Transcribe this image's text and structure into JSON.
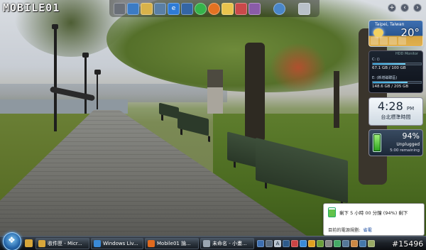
{
  "desktop": {
    "logo_text": "MOBILE01",
    "watermark": "#15496"
  },
  "dock": {
    "icons": [
      "drive-icon",
      "globe-icon",
      "folder-icon",
      "network-icon",
      "ie-icon",
      "media-icon",
      "green-orb-icon",
      "firefox-icon",
      "messenger-icon",
      "mail-icon",
      "photo-icon",
      "search-icon",
      "trash-icon"
    ]
  },
  "sidebar": {
    "top_buttons": [
      "+",
      "‹",
      "›"
    ],
    "weather": {
      "location": "Taipei, Taiwan",
      "temperature": "20°",
      "forecast_count": 4
    },
    "hdd_monitor": {
      "title": "HDD Monitor",
      "drives": [
        {
          "label": "C: ()",
          "usage": "67.1 GB / 100 GB",
          "fill": 0.67
        },
        {
          "label": "E: (新增磁碟區)",
          "usage": "",
          "fill": 0.72
        },
        {
          "label": "",
          "usage": "148.6 GB / 205 GB",
          "fill": 0.72
        }
      ]
    },
    "clock": {
      "time": "4:28",
      "ampm": "PM",
      "zone": "台北標準時間"
    },
    "battery": {
      "percent": "94%",
      "status": "Unplugged",
      "remaining": "5:00 remaining",
      "level": 0.94
    }
  },
  "notification": {
    "message": "剩下 5 小時 00 分鐘 (94%) 剩下",
    "plan_label": "目前的電源規劃:",
    "plan_value": "省電"
  },
  "taskbar": {
    "buttons": [
      {
        "label": "收件匣 - Micr...",
        "color": "#d7a63a"
      },
      {
        "label": "Windows Liv...",
        "color": "#3a8ad7"
      },
      {
        "label": "Mobile01 論...",
        "color": "#e06a1e"
      },
      {
        "label": "未命名 - 小畫...",
        "color": "#9aa6b2"
      }
    ],
    "colors": {
      "accent": "#2464a8",
      "battery_green": "#2ea51e"
    }
  }
}
